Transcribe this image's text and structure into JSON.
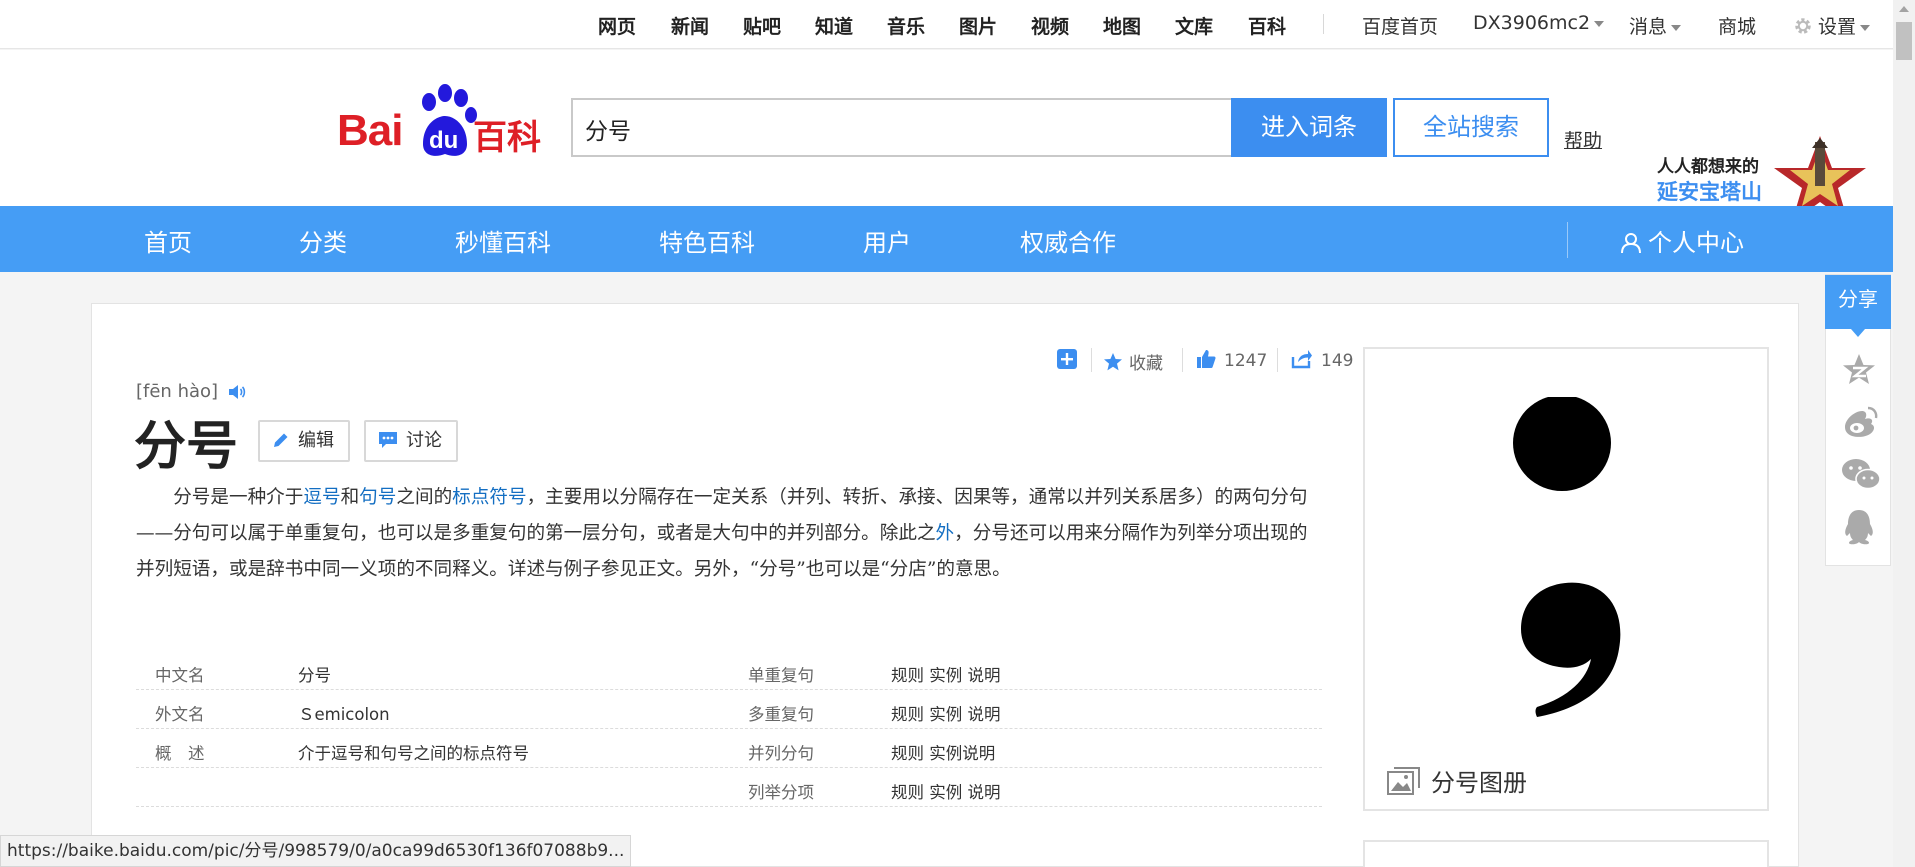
{
  "topbar": {
    "products": [
      "网页",
      "新闻",
      "贴吧",
      "知道",
      "音乐",
      "图片",
      "视频",
      "地图",
      "文库",
      "百科"
    ],
    "home": "百度首页",
    "user": "DX3906mc2",
    "messages": "消息",
    "mall": "商城",
    "settings": "设置"
  },
  "header": {
    "logo_text": "Bai",
    "logo_du": "du",
    "logo_suffix": "百科",
    "search_value": "分号",
    "enter_label": "进入词条",
    "site_search_label": "全站搜索",
    "help_label": "帮助",
    "promo_line1": "人人都想来的",
    "promo_line2": "延安宝塔山"
  },
  "nav": {
    "items": [
      "首页",
      "分类",
      "秒懂百科",
      "特色百科",
      "用户",
      "权威合作"
    ],
    "personal": "个人中心"
  },
  "toolbar": {
    "favorite": "收藏",
    "likes": "1247",
    "shares": "149"
  },
  "entry": {
    "pinyin": "[fēn hào]",
    "title": "分号",
    "edit_label": "编辑",
    "discuss_label": "讨论",
    "summary_parts": [
      {
        "text": "分号是一种介于",
        "link": false
      },
      {
        "text": "逗号",
        "link": true
      },
      {
        "text": "和",
        "link": false
      },
      {
        "text": "句号",
        "link": true
      },
      {
        "text": "之间的",
        "link": false
      },
      {
        "text": "标点符号",
        "link": true
      },
      {
        "text": "，主要用以分隔存在一定关系（并列、转折、承接、因果等，通常以并列关系居多）的两句分句——分句可以属于单重复句，也可以是多重复句的第一层分句，或者是大句中的并列部分。除此之",
        "link": false
      },
      {
        "text": "外",
        "link": true
      },
      {
        "text": "，分号还可以用来分隔作为列举分项出现的并列短语，或是辞书中同一义项的不同释义。详述与例子参见正文。另外，“分号”也可以是“分店”的意思。",
        "link": false
      }
    ]
  },
  "info": {
    "rows": [
      {
        "k1": "中文名",
        "v1": "分号",
        "k2": "单重复句",
        "v2": "规则 实例 说明"
      },
      {
        "k1": "外文名",
        "v1": "Ｓemicolon",
        "k2": "多重复句",
        "v2": "规则 实例 说明"
      },
      {
        "k1": "概　述",
        "v1": "介于逗号和句号之间的标点符号",
        "k2": "并列分句",
        "v2": "规则 实例说明"
      },
      {
        "k1": "",
        "v1": "",
        "k2": "列举分项",
        "v2": "规则 实例 说明"
      }
    ]
  },
  "album": {
    "caption": "分号图册"
  },
  "share": {
    "label": "分享"
  },
  "status_url": "https://baike.baidu.com/pic/分号/998579/0/a0ca99d6530f136f07088b9...",
  "colors": {
    "accent": "#459df5",
    "button": "#3c8ef0",
    "brand_red": "#de1f26",
    "link": "#136ec2"
  }
}
